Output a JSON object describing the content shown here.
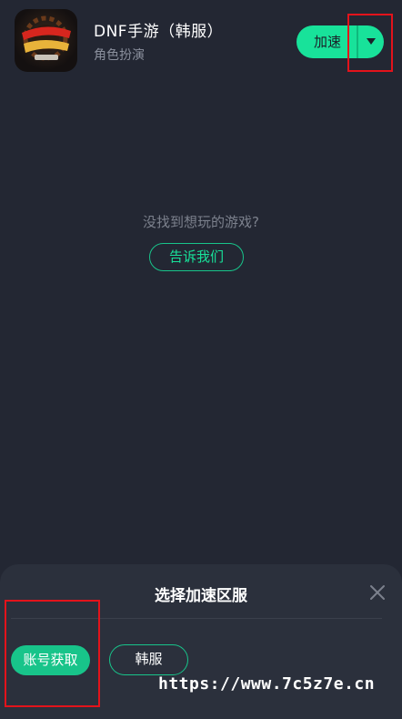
{
  "game": {
    "name": "DNF手游（韩服）",
    "genre": "角色扮演",
    "icon": "dungeon-fighter-mobile-logo"
  },
  "accelerate_button": {
    "label": "加速",
    "dropdown_icon": "triangle-down-icon"
  },
  "empty_state": {
    "hint": "没找到想玩的游戏?",
    "tell_us_label": "告诉我们"
  },
  "server_sheet": {
    "title": "选择加速区服",
    "close_icon": "close-icon",
    "options": [
      {
        "label": "账号获取",
        "selected": true
      },
      {
        "label": "韩服",
        "selected": false
      }
    ]
  },
  "watermark": "https://www.7c5z7e.cn",
  "colors": {
    "background": "#232733",
    "sheet": "#2b303c",
    "accent": "#18e29a",
    "annotation": "#e3131b"
  }
}
